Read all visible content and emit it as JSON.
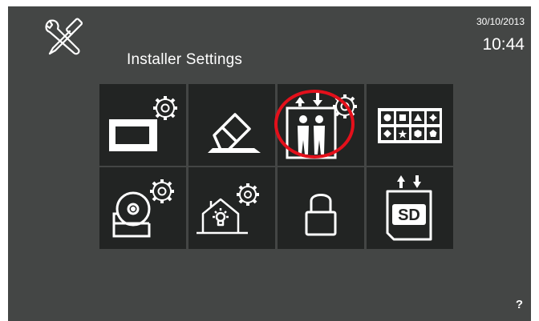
{
  "header": {
    "title": "Installer Settings",
    "date": "30/10/2013",
    "time": "10:44",
    "settings_icon": "wrench-screwdriver-icon"
  },
  "menu": {
    "tiles": [
      {
        "icon": "monitor-settings-icon"
      },
      {
        "icon": "eraser-icon"
      },
      {
        "icon": "lift-settings-icon"
      },
      {
        "icon": "symbol-keypad-icon",
        "highlighted": true
      },
      {
        "icon": "bell-settings-icon"
      },
      {
        "icon": "home-light-settings-icon"
      },
      {
        "icon": "padlock-icon"
      },
      {
        "icon": "sd-card-transfer-icon"
      }
    ]
  },
  "footer": {
    "help_label": "?"
  },
  "colors": {
    "background": "#444645",
    "tile": "#222423",
    "highlight": "#e3101b",
    "text": "#ffffff"
  }
}
